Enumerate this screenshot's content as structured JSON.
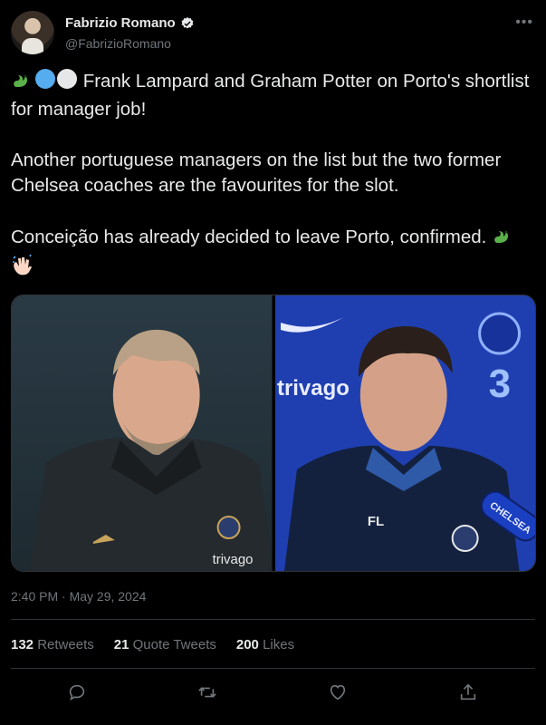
{
  "author": {
    "display_name": "Fabrizio Romano",
    "handle": "@FabrizioRomano",
    "verified": true
  },
  "more_icon": "more-dots-icon",
  "tweet": {
    "paragraphs": [
      "Frank Lampard and Graham Potter on Porto's shortlist for manager job!",
      "Another portuguese managers on the list but the two former Chelsea coaches are the favourites for the slot.",
      "Conceição has already decided to leave Porto, confirmed."
    ],
    "lead_emojis": [
      "dragon-emoji",
      "blue-circle-emoji",
      "white-circle-emoji"
    ],
    "trail_emojis": [
      "dragon-emoji",
      "waving-hand-emoji"
    ]
  },
  "media": {
    "photos": [
      {
        "name": "photo-graham-potter",
        "sponsor_text": "trivago"
      },
      {
        "name": "photo-frank-lampard",
        "sponsor_text": "trivago",
        "shirt_initials": "FL",
        "mic_text": "CHELSEA"
      }
    ]
  },
  "timestamp": "2:40 PM · May 29, 2024",
  "stats": [
    {
      "count": "132",
      "label": "Retweets"
    },
    {
      "count": "21",
      "label": "Quote Tweets"
    },
    {
      "count": "200",
      "label": "Likes"
    }
  ],
  "actions": [
    "reply-icon",
    "retweet-icon",
    "like-icon",
    "share-icon"
  ],
  "colors": {
    "background": "#000000",
    "text": "#e7e9ea",
    "secondary": "#71767b",
    "divider": "#2f3336",
    "verified": "#1d9bf0"
  }
}
